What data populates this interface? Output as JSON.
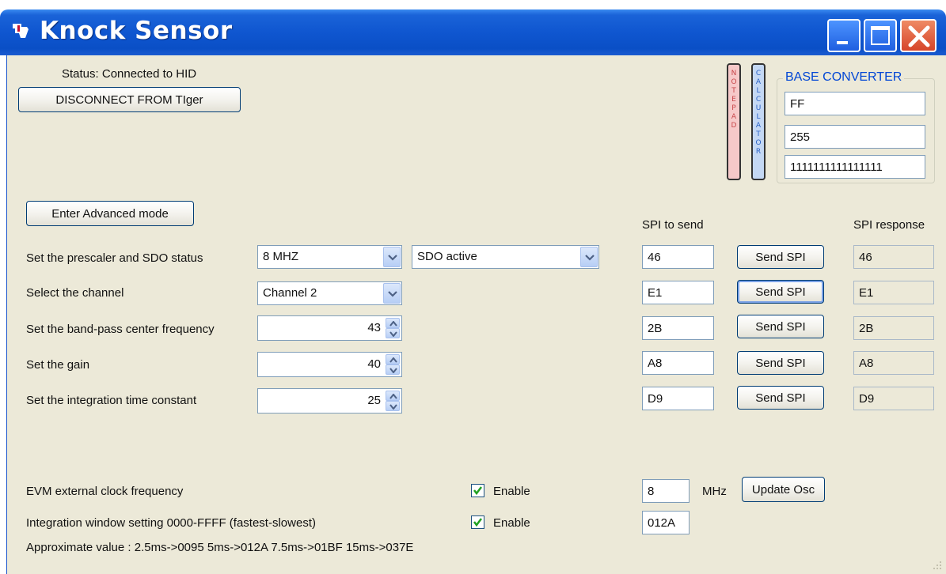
{
  "window": {
    "title": "Knock Sensor"
  },
  "status": {
    "text": "Status: Connected to HID",
    "disconnect_label": "DISCONNECT FROM TIger"
  },
  "side_buttons": {
    "notepad": "NOTEPAD",
    "calculator": "CALCULATOR"
  },
  "base_converter": {
    "title": "BASE CONVERTER",
    "hex": "FF",
    "dec": "255",
    "bin": "1111111111111111"
  },
  "advanced_label": "Enter Advanced mode",
  "headers": {
    "spi_to_send": "SPI to send",
    "spi_response": "SPI response"
  },
  "rows": [
    {
      "label": "Set the prescaler and SDO status",
      "control": "combo2",
      "value": "8 MHZ",
      "value2": "SDO active",
      "spi": "46",
      "button": "Send SPI",
      "response": "46"
    },
    {
      "label": "Select the channel",
      "control": "combo",
      "value": "Channel 2",
      "spi": "E1",
      "button": "Send SPI",
      "response": "E1"
    },
    {
      "label": "Set the band-pass center frequency",
      "control": "spin",
      "value": "43",
      "spi": "2B",
      "button": "Send SPI",
      "response": "2B"
    },
    {
      "label": "Set the gain",
      "control": "spin",
      "value": "40",
      "spi": "A8",
      "button": "Send SPI",
      "response": "A8"
    },
    {
      "label": "Set the integration time constant",
      "control": "spin",
      "value": "25",
      "spi": "D9",
      "button": "Send SPI",
      "response": "D9"
    }
  ],
  "evm": {
    "label": "EVM external clock frequency",
    "enable_label": "Enable",
    "enabled": true,
    "value": "8",
    "unit": "MHz",
    "update_label": "Update Osc"
  },
  "integration_window": {
    "label": "Integration window setting 0000-FFFF (fastest-slowest)",
    "enable_label": "Enable",
    "enabled": true,
    "value": "012A"
  },
  "approx_text": "Approximate value : 2.5ms->0095  5ms->012A  7.5ms->01BF  15ms->037E",
  "colors": {
    "titlebar": "#0f56d0",
    "client": "#ece9d8",
    "groupbox_title": "#0046d5"
  }
}
